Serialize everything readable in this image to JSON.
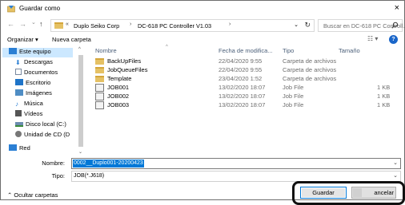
{
  "window": {
    "title": "Guardar como",
    "close_glyph": "×"
  },
  "nav": {
    "back": "←",
    "forward": "→",
    "up": "↑"
  },
  "address": {
    "prefix": "«",
    "segments": [
      "Duplo Seiko Corp",
      "DC-618 PC Controller V1.03"
    ],
    "separator": "›",
    "dropdown": "⌄",
    "refresh": "↻"
  },
  "search": {
    "placeholder": "Buscar en DC-618 PC Controll..."
  },
  "toolbar": {
    "organize": "Organizar ▾",
    "new_folder": "Nueva carpeta",
    "view": "☷ ▾",
    "help": "?"
  },
  "sidebar": {
    "items": [
      {
        "label": "Este equipo",
        "icon": "computer-icon",
        "color": "#2b7fd4"
      },
      {
        "label": "Descargas",
        "icon": "download-icon",
        "color": "#2b7fd4"
      },
      {
        "label": "Documentos",
        "icon": "documents-icon",
        "color": "#7a8aa0"
      },
      {
        "label": "Escritorio",
        "icon": "desktop-icon",
        "color": "#1e74c8"
      },
      {
        "label": "Imágenes",
        "icon": "pictures-icon",
        "color": "#4f8dc4"
      },
      {
        "label": "Música",
        "icon": "music-icon",
        "color": "#2b7fd4"
      },
      {
        "label": "Vídeos",
        "icon": "videos-icon",
        "color": "#555"
      },
      {
        "label": "Disco local (C:)",
        "icon": "drive-icon",
        "color": "#6d8db0"
      },
      {
        "label": "Unidad de CD (D",
        "icon": "cd-drive-icon",
        "color": "#777"
      },
      {
        "label": "Red",
        "icon": "network-icon",
        "color": "#2b7fd4"
      }
    ]
  },
  "files": {
    "headers": {
      "name": "Nombre",
      "date": "Fecha de modifica...",
      "type": "Tipo",
      "size": "Tamaño"
    },
    "sort_caret": "^",
    "rows": [
      {
        "name": "BackUpFiles",
        "date": "22/04/2020 9:55",
        "type": "Carpeta de archivos",
        "size": "",
        "kind": "folder"
      },
      {
        "name": "JobQueueFiles",
        "date": "22/04/2020 9:55",
        "type": "Carpeta de archivos",
        "size": "",
        "kind": "folder"
      },
      {
        "name": "Template",
        "date": "23/04/2020 1:52",
        "type": "Carpeta de archivos",
        "size": "",
        "kind": "folder"
      },
      {
        "name": "JOB001",
        "date": "13/02/2020 18:07",
        "type": "Job File",
        "size": "1 KB",
        "kind": "job"
      },
      {
        "name": "JOB002",
        "date": "13/02/2020 18:07",
        "type": "Job File",
        "size": "1 KB",
        "kind": "job"
      },
      {
        "name": "JOB003",
        "date": "13/02/2020 18:07",
        "type": "Job File",
        "size": "1 KB",
        "kind": "job"
      }
    ]
  },
  "form": {
    "name_label": "Nombre:",
    "name_value": "0002__Duplo001-20200423",
    "type_label": "Tipo:",
    "type_value": "JOB(*.J618)"
  },
  "footer": {
    "hide_folders": "⌃  Ocultar carpetas",
    "save": "Guardar",
    "cancel": "ancelar"
  },
  "colors": {
    "accent": "#0078d7",
    "folder": "#e5c164",
    "selection": "#cce8ff"
  }
}
